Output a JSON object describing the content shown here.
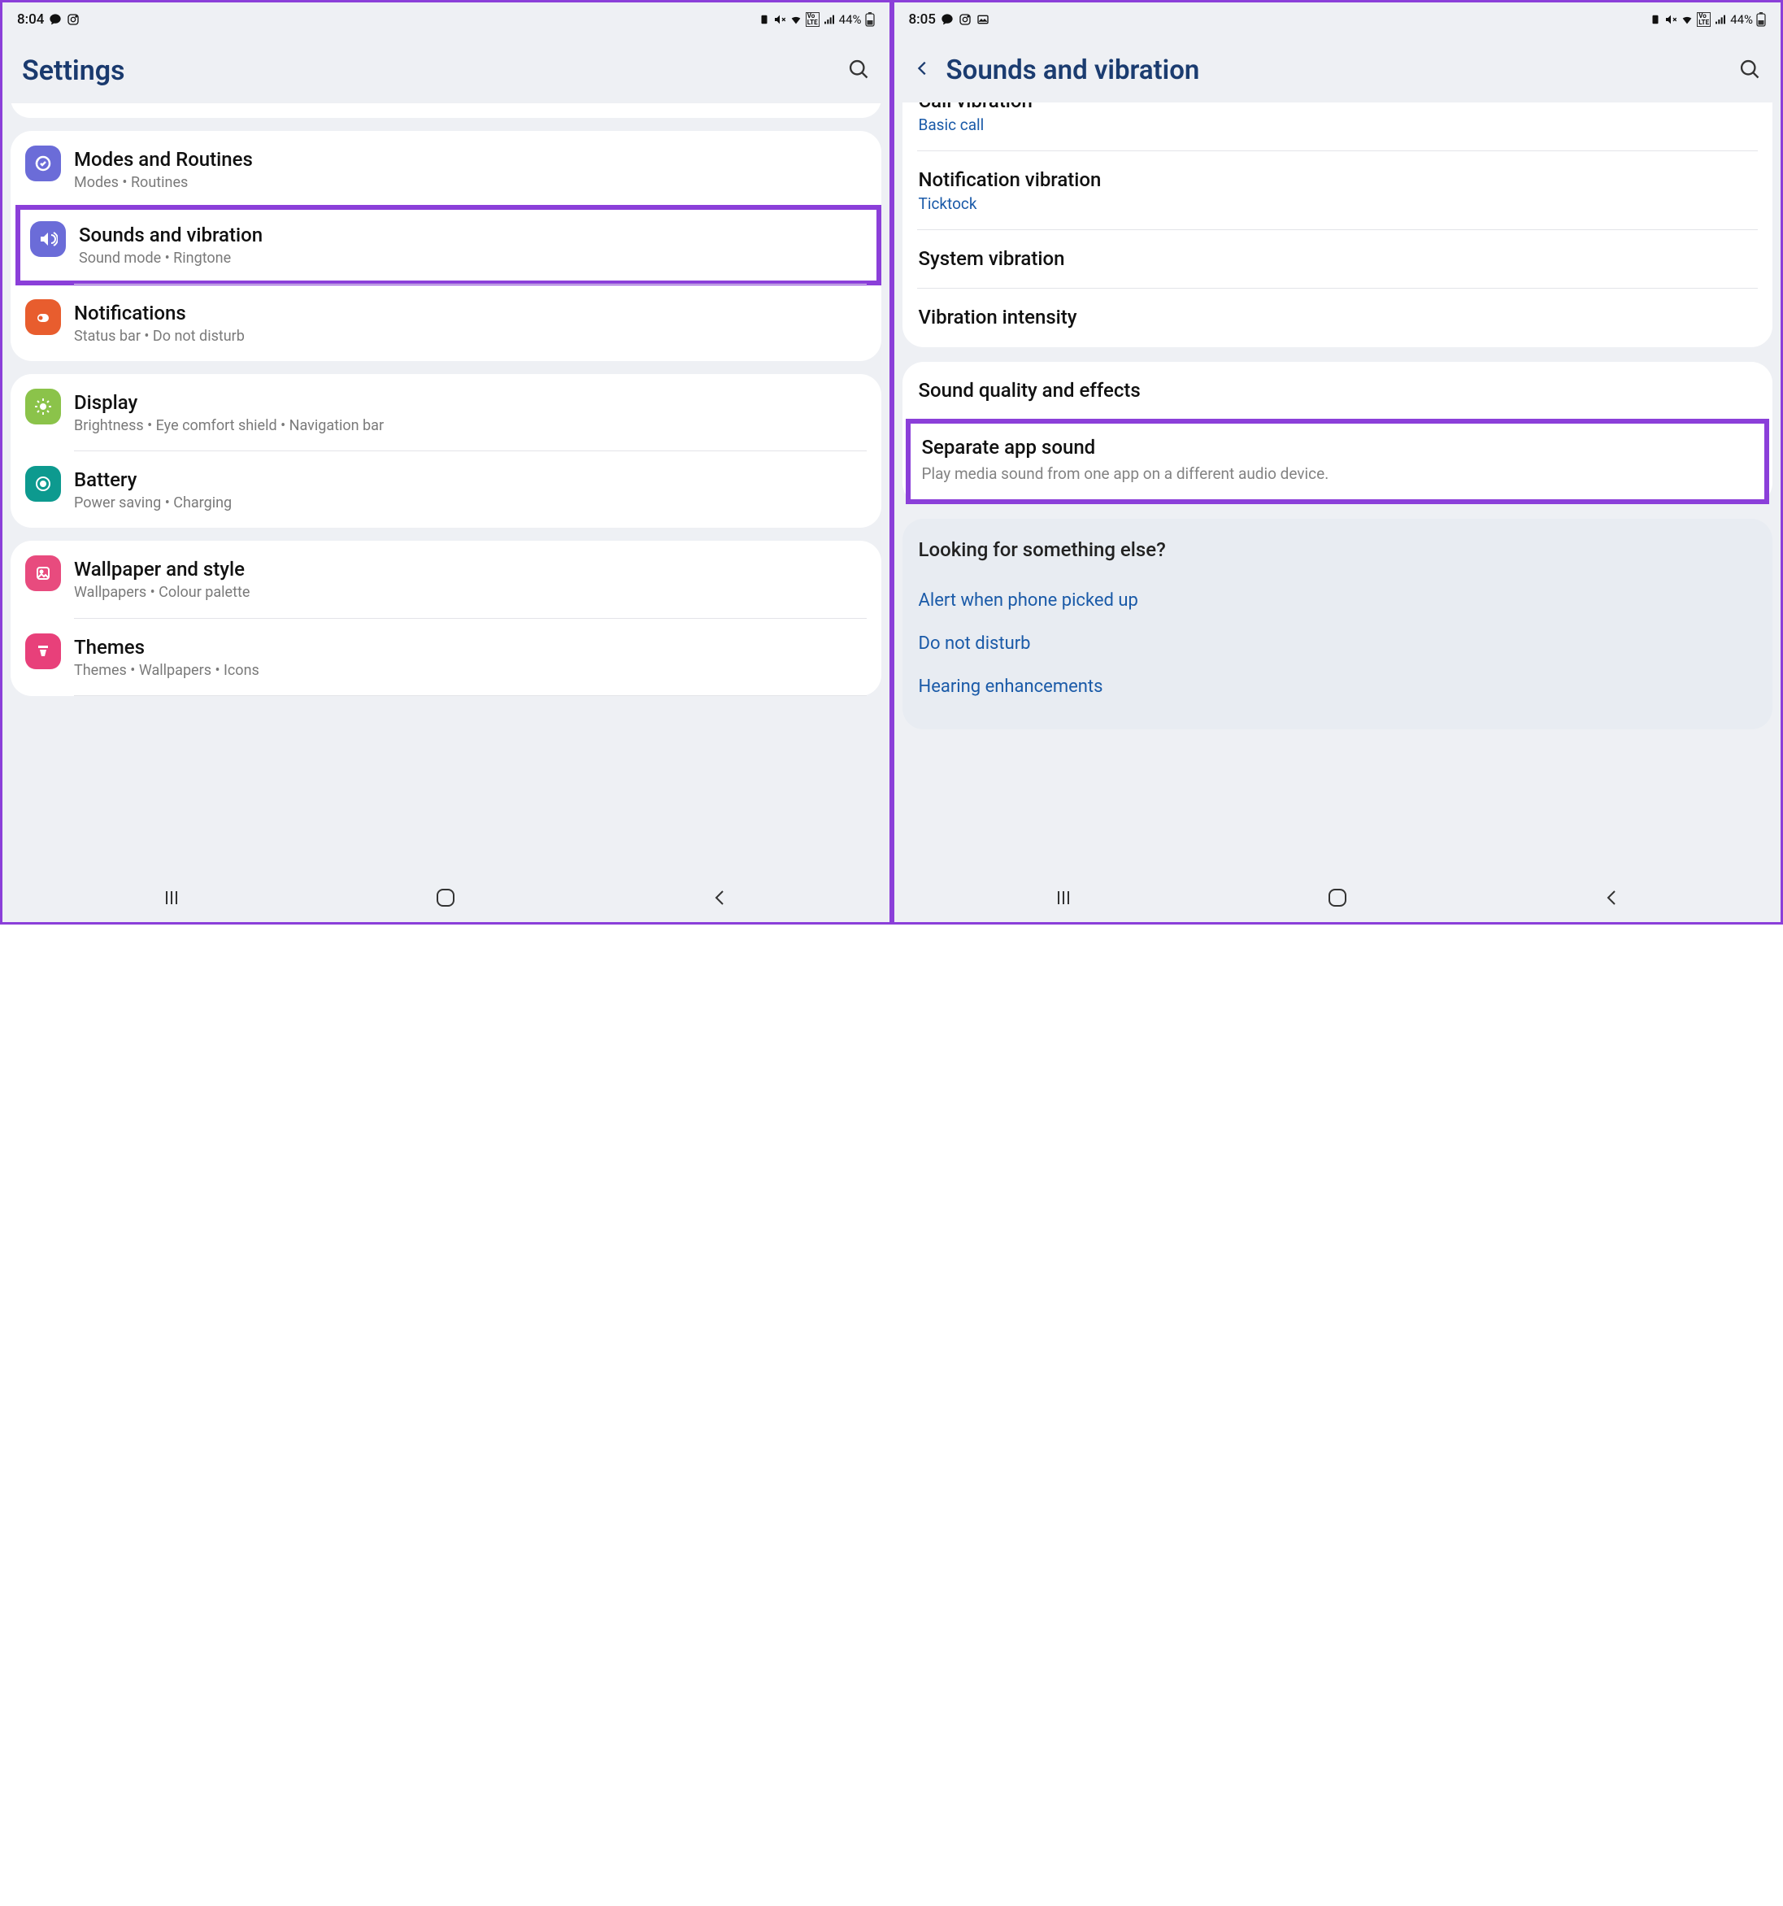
{
  "screen1": {
    "status": {
      "time": "8:04",
      "battery": "44%"
    },
    "title": "Settings",
    "rows": [
      {
        "title": "Modes and Routines",
        "sub": "Modes  •  Routines"
      },
      {
        "title": "Sounds and vibration",
        "sub": "Sound mode  •  Ringtone"
      },
      {
        "title": "Notifications",
        "sub": "Status bar  •  Do not disturb"
      },
      {
        "title": "Display",
        "sub": "Brightness  •  Eye comfort shield  •  Navigation bar"
      },
      {
        "title": "Battery",
        "sub": "Power saving  •  Charging"
      },
      {
        "title": "Wallpaper and style",
        "sub": "Wallpapers  •  Colour palette"
      },
      {
        "title": "Themes",
        "sub": "Themes  •  Wallpapers  •  Icons"
      }
    ]
  },
  "screen2": {
    "status": {
      "time": "8:05",
      "battery": "44%"
    },
    "title": "Sounds and vibration",
    "cut_item": {
      "title": "Call vibration",
      "sub": "Basic call"
    },
    "group1": [
      {
        "title": "Notification vibration",
        "sub": "Ticktock"
      },
      {
        "title": "System vibration"
      },
      {
        "title": "Vibration intensity"
      }
    ],
    "group2": [
      {
        "title": "Sound quality and effects"
      },
      {
        "title": "Separate app sound",
        "desc": "Play media sound from one app on a different audio device."
      }
    ],
    "looking": {
      "title": "Looking for something else?",
      "links": [
        "Alert when phone picked up",
        "Do not disturb",
        "Hearing enhancements"
      ]
    }
  }
}
